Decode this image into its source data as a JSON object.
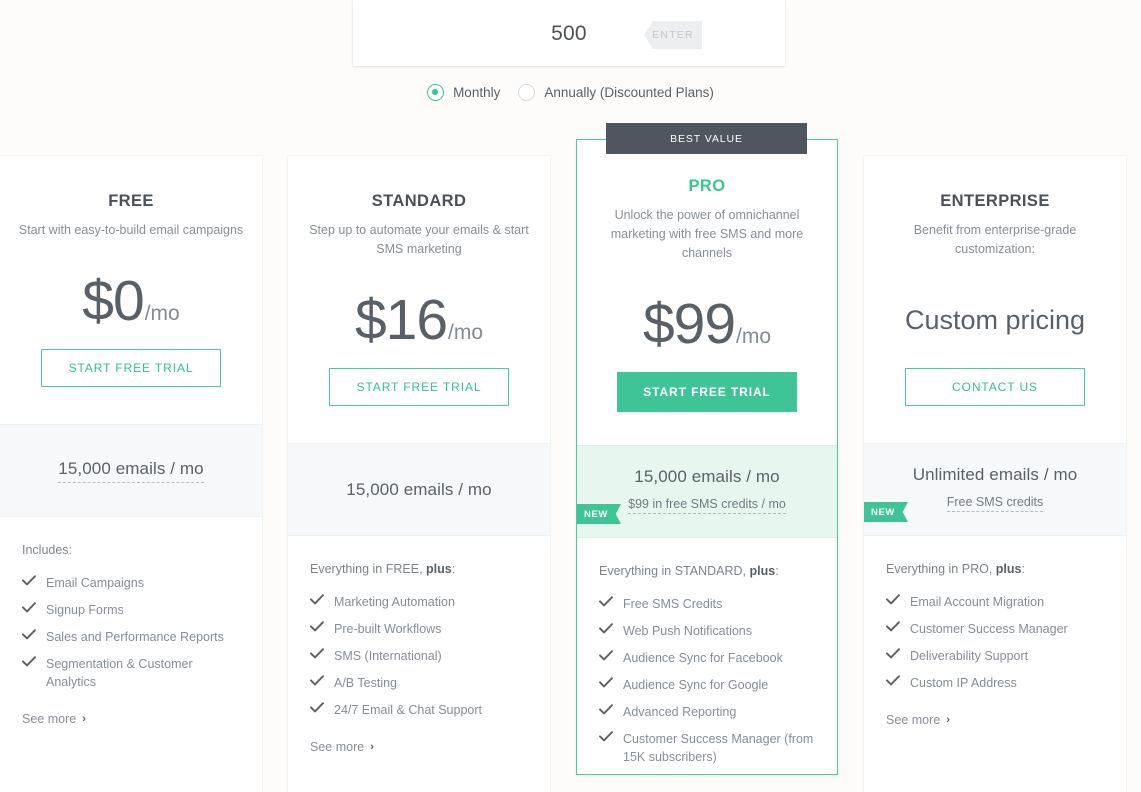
{
  "subscriber_input": {
    "value": "500",
    "placeholder": "500",
    "enter_label": "ENTER"
  },
  "billing": {
    "options": [
      {
        "label": "Monthly",
        "selected": true
      },
      {
        "label": "Annually (Discounted Plans)",
        "selected": false
      }
    ]
  },
  "badges": {
    "best_value": "BEST VALUE",
    "new": "NEW"
  },
  "see_more_label": "See more",
  "chevron": "›",
  "colors": {
    "accent": "#3ec496",
    "accent_text": "#36c98e",
    "banner_dark": "#4e565f",
    "page_bg": "#fdfcfa",
    "band_bg": "#f7f8f9",
    "band_bg_featured": "#e7f6ef"
  },
  "plans": [
    {
      "name": "FREE",
      "description": "Start with easy-to-build email campaigns",
      "price_main": "$0",
      "price_suffix": "/mo",
      "cta_label": "START FREE TRIAL",
      "volume_main": "15,000 emails / mo",
      "volume_sub": null,
      "features_title_prefix": "Includes:",
      "features_title_bold": "",
      "features_title_suffix": "",
      "features": [
        "Email Campaigns",
        "Signup Forms",
        "Sales and Performance Reports",
        "Segmentation & Customer Analytics"
      ]
    },
    {
      "name": "STANDARD",
      "description": "Step up to automate your emails & start SMS marketing",
      "price_main": "$16",
      "price_suffix": "/mo",
      "cta_label": "START FREE TRIAL",
      "volume_main": "15,000 emails / mo",
      "volume_sub": null,
      "features_title_prefix": "Everything in FREE, ",
      "features_title_bold": "plus",
      "features_title_suffix": ":",
      "features": [
        "Marketing Automation",
        "Pre-built Workflows",
        "SMS (International)",
        "A/B Testing",
        "24/7 Email & Chat Support"
      ]
    },
    {
      "name": "PRO",
      "description": "Unlock the power of omnichannel marketing with free SMS and more channels",
      "price_main": "$99",
      "price_suffix": "/mo",
      "cta_label": "START FREE TRIAL",
      "volume_main": "15,000 emails / mo",
      "volume_sub": "$99 in free SMS credits / mo",
      "features_title_prefix": "Everything in STANDARD, ",
      "features_title_bold": "plus",
      "features_title_suffix": ":",
      "features": [
        "Free SMS Credits",
        "Web Push Notifications",
        "Audience Sync for Facebook",
        "Audience Sync for Google",
        "Advanced Reporting",
        "Customer Success Manager (from 15K subscribers)"
      ]
    },
    {
      "name": "ENTERPRISE",
      "description": "Benefit from enterprise-grade customization:",
      "price_main": "Custom pricing",
      "price_suffix": "",
      "cta_label": "CONTACT US",
      "volume_main": "Unlimited emails / mo",
      "volume_sub": "Free SMS credits",
      "features_title_prefix": "Everything in PRO, ",
      "features_title_bold": "plus",
      "features_title_suffix": ":",
      "features": [
        "Email Account Migration",
        "Customer Success Manager",
        "Deliverability Support",
        "Custom IP Address"
      ]
    }
  ]
}
